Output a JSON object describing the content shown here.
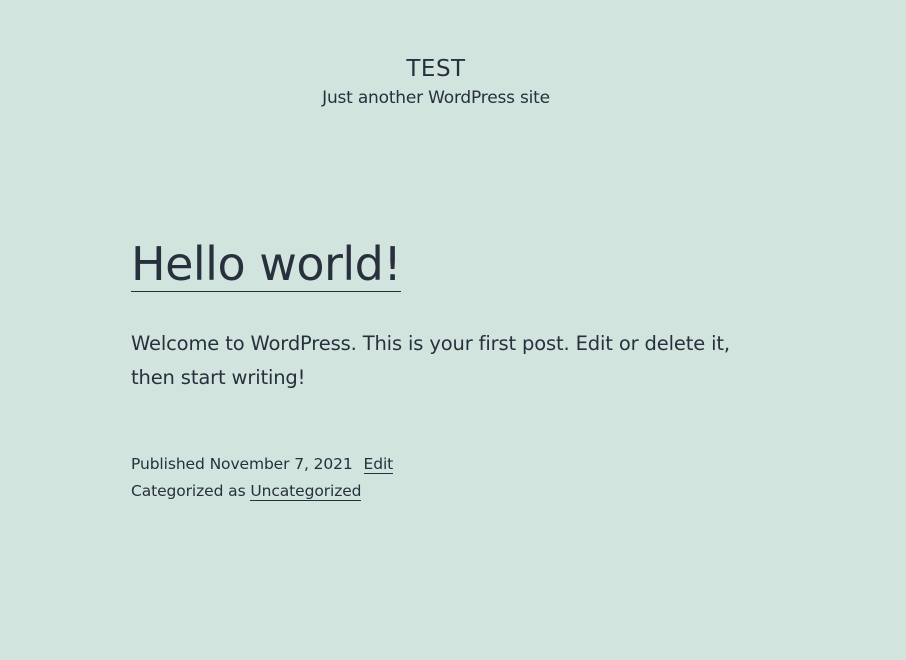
{
  "site": {
    "title": "TEST",
    "description": "Just another WordPress site"
  },
  "post": {
    "title": "Hello world!",
    "content": "Welcome to WordPress. This is your first post. Edit or delete it, then start writing!",
    "published_label": "Published",
    "published_date": "November 7, 2021",
    "edit_label": "Edit",
    "categorized_label": "Categorized as",
    "category": "Uncategorized"
  },
  "colors": {
    "background": "#d1e4dd",
    "text": "#28303d"
  }
}
